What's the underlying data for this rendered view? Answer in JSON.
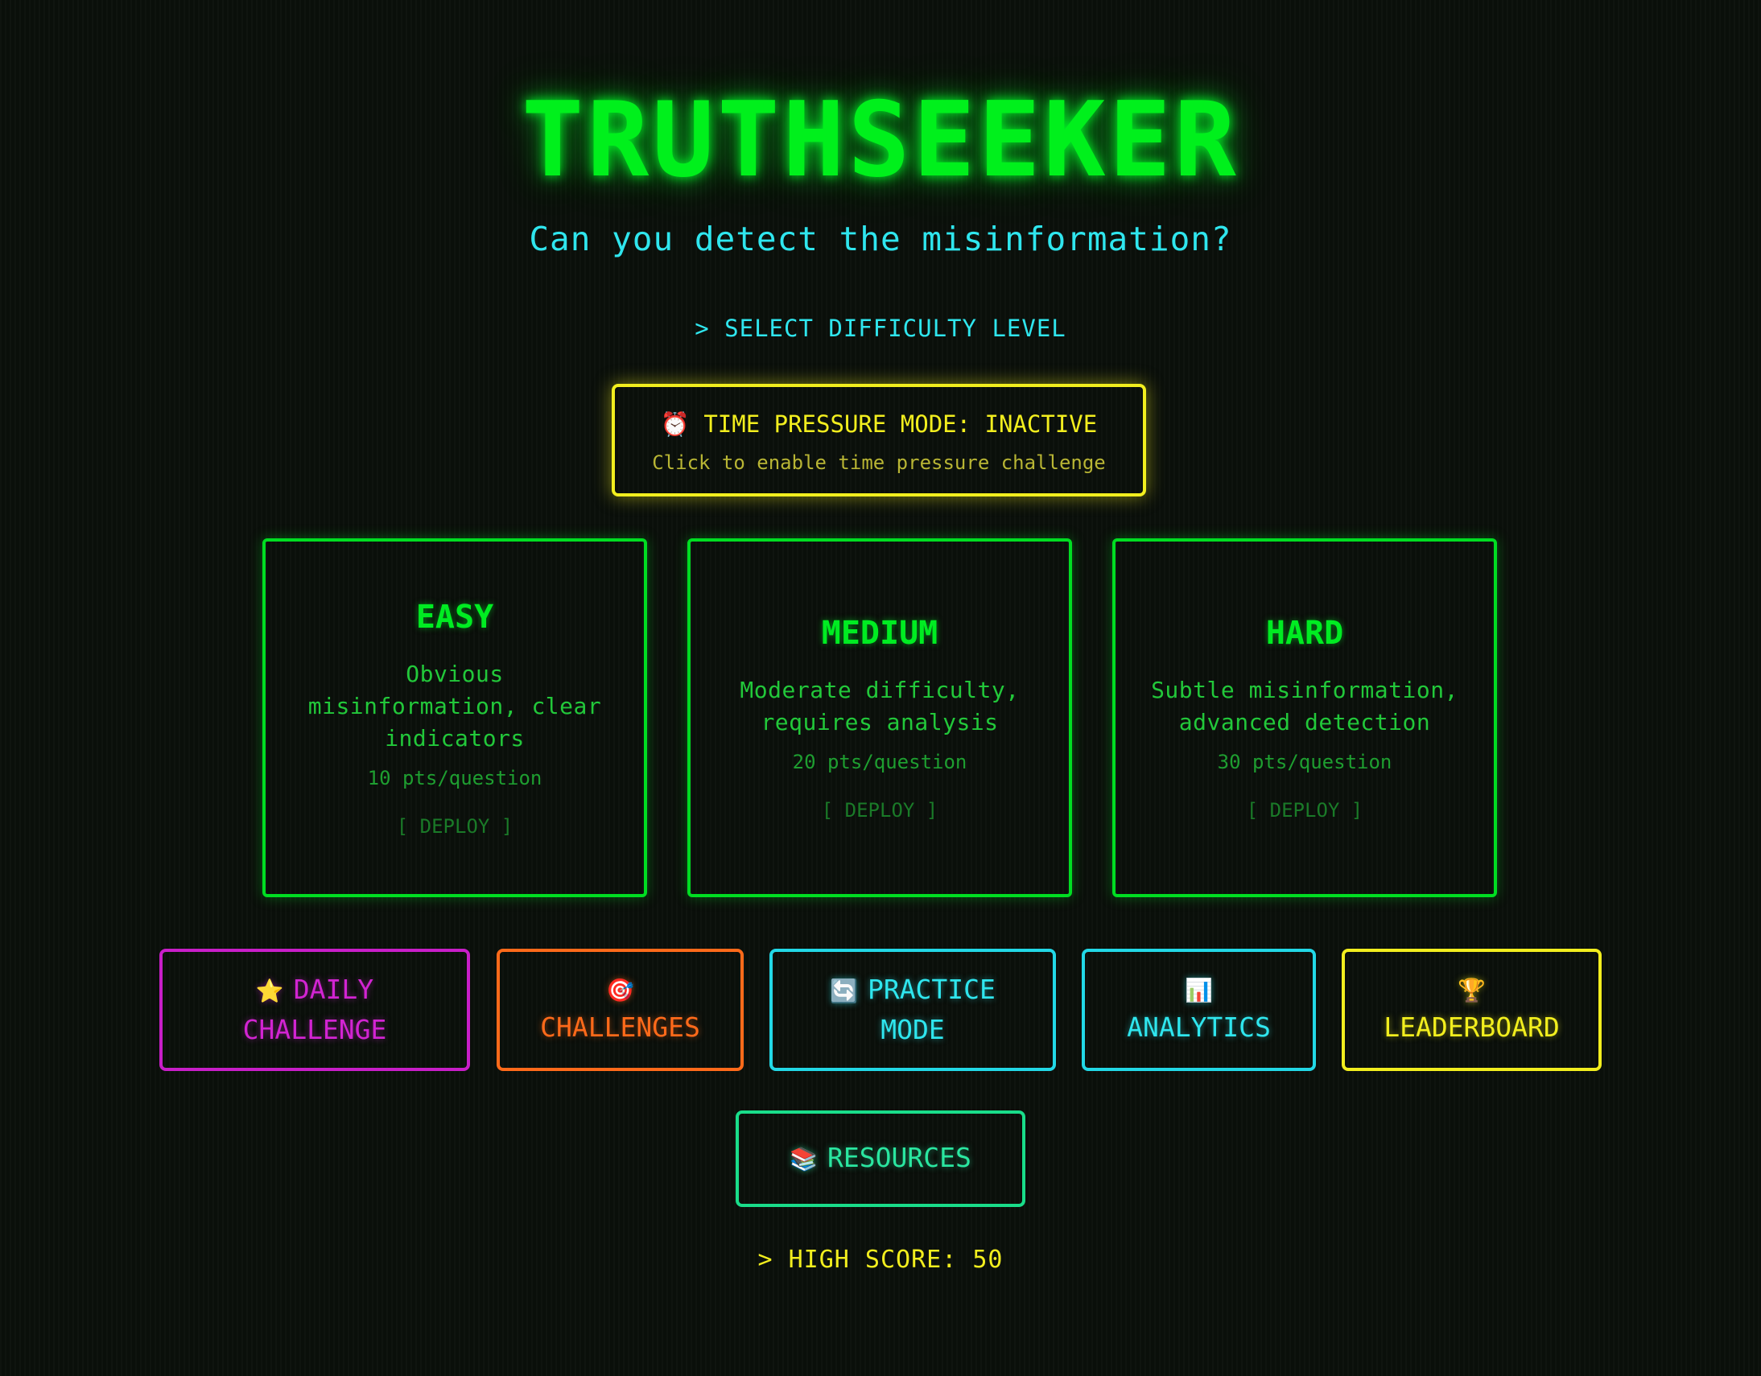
{
  "title": "TRUTHSEEKER",
  "subtitle": "Can you detect the misinformation?",
  "select_label": "> SELECT DIFFICULTY LEVEL",
  "time_pressure": {
    "icon": "alarm-clock-icon",
    "label": "TIME PRESSURE MODE: INACTIVE",
    "hint": "Click to enable time pressure challenge",
    "color": "#f2ee1e"
  },
  "difficulties": [
    {
      "name": "EASY",
      "description": "Obvious misinformation, clear indicators",
      "points": "10 pts/question",
      "action": "[ DEPLOY ]"
    },
    {
      "name": "MEDIUM",
      "description": "Moderate difficulty, requires analysis",
      "points": "20 pts/question",
      "action": "[ DEPLOY ]"
    },
    {
      "name": "HARD",
      "description": "Subtle misinformation, advanced detection",
      "points": "30 pts/question",
      "action": "[ DEPLOY ]"
    }
  ],
  "modes": {
    "daily": {
      "icon": "star-icon",
      "glyph": "⭐",
      "line1": "DAILY",
      "line2": "CHALLENGE",
      "color": "#d224d2"
    },
    "challenges": {
      "icon": "target-icon",
      "glyph": "🎯",
      "label": "CHALLENGES",
      "color": "#ff6a1a"
    },
    "practice": {
      "icon": "refresh-icon",
      "glyph": "🔄",
      "line1": "PRACTICE",
      "line2": "MODE",
      "color": "#2fe6ee"
    },
    "analytics": {
      "icon": "bar-chart-icon",
      "glyph": "📊",
      "label": "ANALYTICS",
      "color": "#2fe6ee"
    },
    "leaderboard": {
      "icon": "trophy-icon",
      "glyph": "🏆",
      "label": "LEADERBOARD",
      "color": "#f2ee1e"
    },
    "resources": {
      "icon": "books-icon",
      "glyph": "📚",
      "label": "RESOURCES",
      "color": "#2ae6a0"
    }
  },
  "high_score": "> HIGH SCORE: 50",
  "colors": {
    "background": "#0a0f0a",
    "primary_green": "#00e01a",
    "cyan": "#2fe6ee"
  }
}
